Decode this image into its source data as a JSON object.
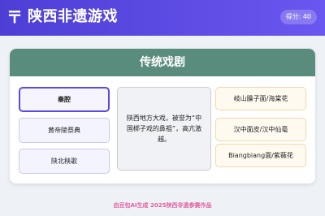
{
  "header": {
    "logo_glyph": "〒",
    "title": "陕西非遗游戏",
    "score": "得分: 40"
  },
  "card": {
    "title": "传统戏剧",
    "left_options": [
      {
        "label": "秦腔",
        "selected": true
      },
      {
        "label": "黄帝陵祭典",
        "selected": false
      },
      {
        "label": "陕北秧歌",
        "selected": false
      }
    ],
    "description": "陕西地方大戏，被誉为“中国梆子戏的鼻祖”，高亢激越。",
    "right_options": [
      {
        "label": "岐山臊子面/海棠花"
      },
      {
        "label": "汉中面皮/汉中仙毫"
      },
      {
        "label": "Biangbiang面/紫薇花"
      }
    ]
  },
  "footer": {
    "text": "由豆包AI生成 2025陕西非遗参赛作品"
  },
  "colors": {
    "header_accent": "#5a4ae3",
    "card_header": "#5a8c7d",
    "selected_border": "#5b4be0",
    "footer_text": "#e060a0"
  }
}
